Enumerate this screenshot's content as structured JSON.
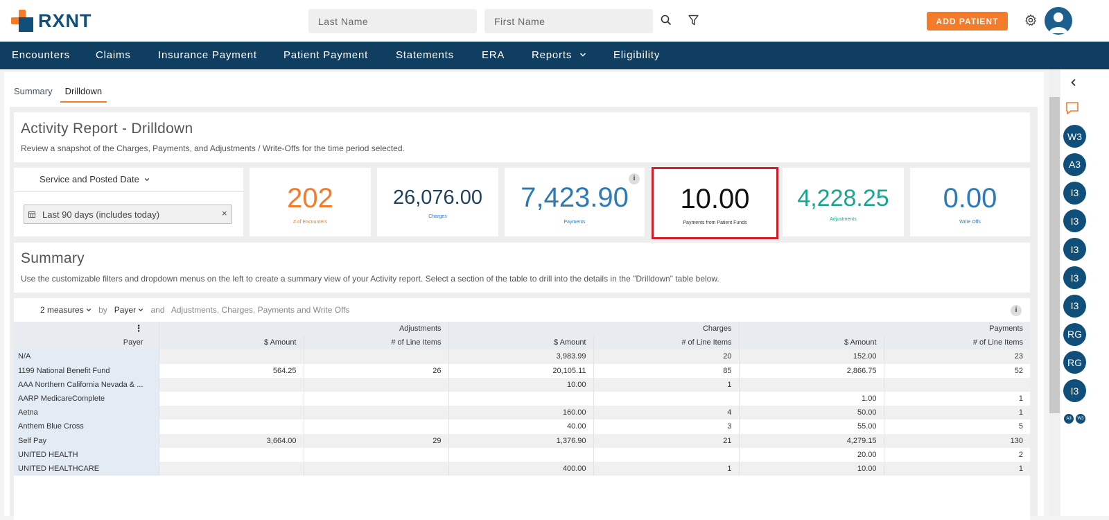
{
  "brand": {
    "name": "RXNT"
  },
  "header": {
    "last_name_placeholder": "Last Name",
    "first_name_placeholder": "First Name",
    "add_patient_label": "ADD PATIENT"
  },
  "nav": {
    "items": [
      "Encounters",
      "Claims",
      "Insurance Payment",
      "Patient Payment",
      "Statements",
      "ERA",
      "Reports",
      "Eligibility"
    ]
  },
  "tabs": [
    "Summary",
    "Drilldown"
  ],
  "activity": {
    "title": "Activity Report - Drilldown",
    "description": "Review a snapshot of the Charges, Payments, and Adjustments / Write-Offs for the time period selected."
  },
  "filter": {
    "label": "Service and Posted Date",
    "value": "Last 90 days (includes today)"
  },
  "kpis": [
    {
      "value": "202",
      "label": "# of Encounters",
      "color": "#f47b2a"
    },
    {
      "value": "26,076.00",
      "label": "Charges",
      "color": "#1d3f5e"
    },
    {
      "value": "7,423.90",
      "label": "Payments",
      "color": "#2b7bb9"
    },
    {
      "value": "10.00",
      "label": "Payments from Patient Funds",
      "color": "#111111"
    },
    {
      "value": "4,228.25",
      "label": "Adjustments",
      "color": "#1aa58f"
    },
    {
      "value": "0.00",
      "label": "Write Offs",
      "color": "#2b7bb9"
    }
  ],
  "summary": {
    "title": "Summary",
    "description": "Use the customizable filters and dropdown menus on the left to create a summary view of your Activity report. Select a section of the table to drill into the details in the \"Drilldown\" table below."
  },
  "pivot": {
    "measures": "2 measures",
    "by": "by",
    "dimension": "Payer",
    "and": "and",
    "series": "Adjustments, Charges, Payments and Write Offs",
    "row_header": "Payer",
    "groups": [
      "Adjustments",
      "Charges",
      "Payments"
    ],
    "subcols": [
      "$ Amount",
      "# of Line Items",
      "$ Amount",
      "# of Line Items",
      "$ Amount",
      "# of Line Items"
    ],
    "rows": [
      {
        "payer": "N/A",
        "cells": [
          "",
          "",
          "3,983.99",
          "20",
          "152.00",
          "23"
        ]
      },
      {
        "payer": "1199 National Benefit Fund",
        "cells": [
          "564.25",
          "26",
          "20,105.11",
          "85",
          "2,866.75",
          "52"
        ]
      },
      {
        "payer": "AAA Northern California Nevada & ...",
        "cells": [
          "",
          "",
          "10.00",
          "1",
          "",
          ""
        ]
      },
      {
        "payer": "AARP MedicareComplete",
        "cells": [
          "",
          "",
          "",
          "",
          "1.00",
          "1"
        ]
      },
      {
        "payer": "Aetna",
        "cells": [
          "",
          "",
          "160.00",
          "4",
          "50.00",
          "1"
        ]
      },
      {
        "payer": "Anthem Blue Cross",
        "cells": [
          "",
          "",
          "40.00",
          "3",
          "55.00",
          "5"
        ]
      },
      {
        "payer": "Self Pay",
        "cells": [
          "3,664.00",
          "29",
          "1,376.90",
          "21",
          "4,279.15",
          "130"
        ]
      },
      {
        "payer": "UNITED HEALTH",
        "cells": [
          "",
          "",
          "",
          "",
          "20.00",
          "2"
        ]
      },
      {
        "payer": "UNITED HEALTHCARE",
        "cells": [
          "",
          "",
          "400.00",
          "1",
          "10.00",
          "1"
        ]
      }
    ]
  },
  "rail": {
    "bubbles": [
      "W3",
      "A3",
      "I3",
      "I3",
      "I3",
      "I3",
      "I3",
      "RG",
      "RG",
      "I3"
    ],
    "mini": [
      "A3",
      "W3"
    ]
  }
}
